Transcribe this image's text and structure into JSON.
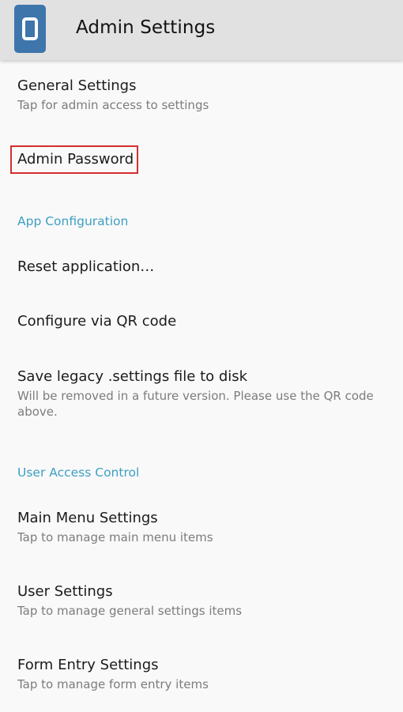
{
  "appbar": {
    "title": "Admin Settings",
    "icon": "app-logo-icon"
  },
  "preferences": {
    "general": {
      "title": "General Settings",
      "summary": "Tap for admin access to settings"
    },
    "admin_password": {
      "title": "Admin Password"
    },
    "app_configuration_header": "App Configuration",
    "reset": {
      "title": "Reset application…"
    },
    "qr": {
      "title": "Configure via QR code"
    },
    "legacy": {
      "title": "Save legacy .settings file to disk",
      "summary": "Will be removed in a future version. Please use the QR code above."
    },
    "user_access_header": "User Access Control",
    "main_menu": {
      "title": "Main Menu Settings",
      "summary": "Tap to manage main menu items"
    },
    "user_settings": {
      "title": "User Settings",
      "summary": "Tap to manage general settings items"
    },
    "form_entry": {
      "title": "Form Entry Settings",
      "summary": "Tap to manage form entry items"
    }
  },
  "colors": {
    "appbar_bg": "#e1e1e1",
    "category_accent": "#3c9fc4",
    "highlight": "#d32f2f",
    "icon_bg": "#3e75ab"
  }
}
